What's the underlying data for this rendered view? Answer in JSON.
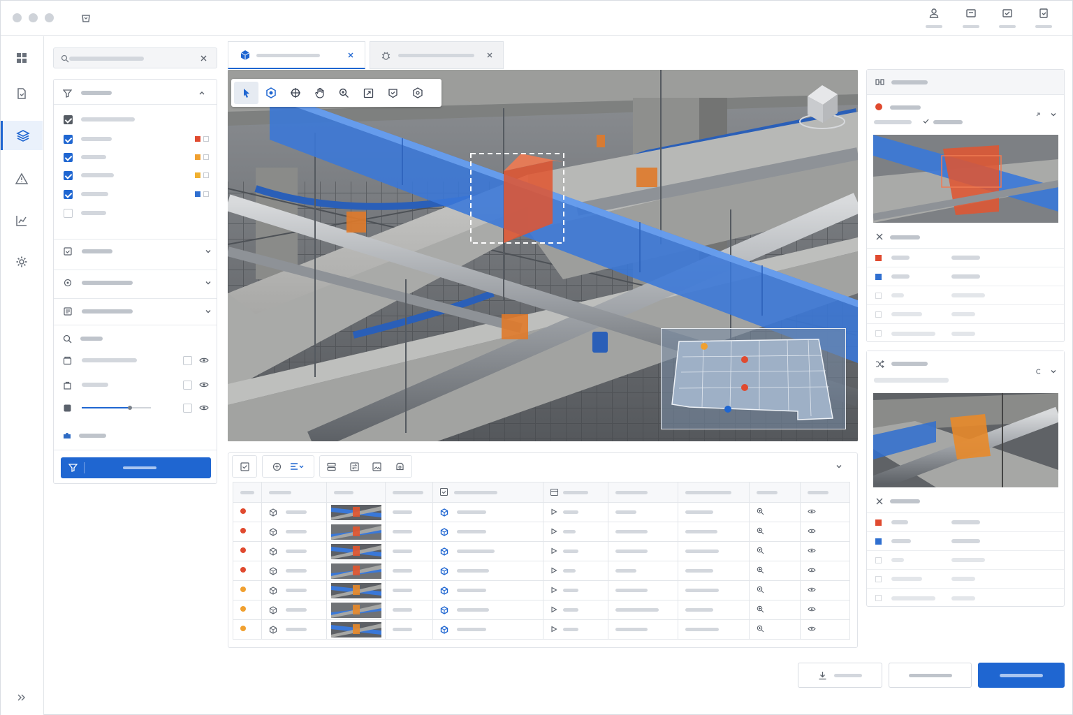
{
  "window": {
    "controls": [
      "close",
      "minimize",
      "maximize"
    ],
    "app_icon": "app-icon",
    "top_icons": [
      "user-icon",
      "inbox-icon",
      "report-icon",
      "clipboard-icon"
    ]
  },
  "rail": {
    "items": [
      "dashboard-icon",
      "document-icon",
      "layers-icon",
      "warning-icon",
      "chart-icon",
      "settings-icon"
    ],
    "active": "layers-icon",
    "expand_icon": "chevron-double-right-icon"
  },
  "filters": {
    "layer_colors": [
      "#e04a2f",
      "#f0a030",
      "#f0b030",
      "#2f6fd0"
    ],
    "slider_level": 0.7
  },
  "viewport": {
    "tools": [
      "select-icon",
      "orbit-icon",
      "section-icon",
      "pan-icon",
      "zoom-icon",
      "fit-icon",
      "isolate-icon",
      "model-icon"
    ],
    "active_tool": "select-icon"
  },
  "table": {
    "rows": [
      {
        "status_color": "#e04a2f"
      },
      {
        "status_color": "#e04a2f"
      },
      {
        "status_color": "#e04a2f"
      },
      {
        "status_color": "#e04a2f"
      },
      {
        "status_color": "#f0a030"
      },
      {
        "status_color": "#f0a030"
      },
      {
        "status_color": "#f0a030"
      }
    ]
  },
  "colors": {
    "accent": "#1f66d1",
    "clash": "#e04a2f",
    "duct": "#2f6fd0",
    "warning": "#f0a030"
  }
}
